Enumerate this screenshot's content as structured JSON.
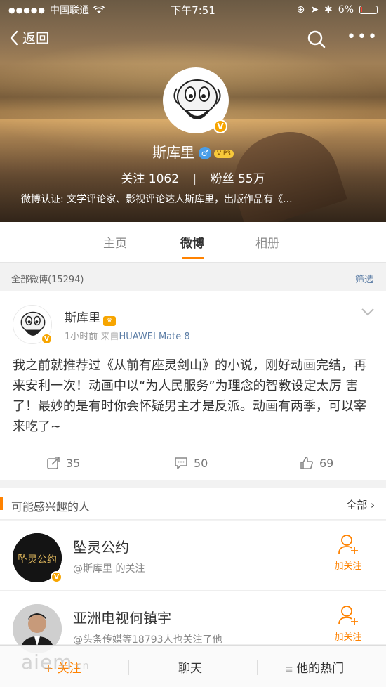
{
  "status_bar": {
    "carrier": "中国联通",
    "time": "下午7:51",
    "battery": "6%"
  },
  "nav": {
    "back_label": "返回"
  },
  "profile": {
    "name": "斯库里",
    "vip_label": "VIP3",
    "verified_mark": "V",
    "following_label": "关注",
    "following_count": "1062",
    "followers_label": "粉丝",
    "followers_count": "55万",
    "verification": "微博认证: 文学评论家、影视评论达人斯库里，出版作品有《..."
  },
  "tabs": [
    {
      "label": "主页",
      "active": false
    },
    {
      "label": "微博",
      "active": true
    },
    {
      "label": "相册",
      "active": false
    }
  ],
  "filter_bar": {
    "all_weibo": "全部微博(15294)",
    "filter": "筛选"
  },
  "post": {
    "author": "斯库里",
    "time": "1小时前",
    "source_prefix": "来自",
    "source": "HUAWEI Mate 8",
    "text": "我之前就推荐过《从前有座灵剑山》的小说，刚好动画完结，再来安利一次！动画中以“为人民服务”为理念的智教设定太厉 害了！最妙的是有时你会怀疑男主才是反派。动画有两季，可以宰来吃了~",
    "reposts": "35",
    "comments": "50",
    "likes": "69"
  },
  "recommend": {
    "title": "可能感兴趣的人",
    "all": "全部",
    "items": [
      {
        "name": "坠灵公约",
        "desc": "@斯库里 的关注",
        "follow": "加关注",
        "avatar_text": "坠灵公约"
      },
      {
        "name": "亚洲电视何镇宇",
        "desc": "@头条传媒等18793人也关注了他",
        "follow": "加关注"
      }
    ]
  },
  "bottom_bar": {
    "follow": "+ 关注",
    "chat": "聊天",
    "hot": "他的热门"
  },
  "watermark": {
    "main": "aiem",
    "suffix": ".cn"
  },
  "colors": {
    "accent": "#ff8200",
    "link": "#5d7ea6",
    "verified": "#f7a500"
  }
}
